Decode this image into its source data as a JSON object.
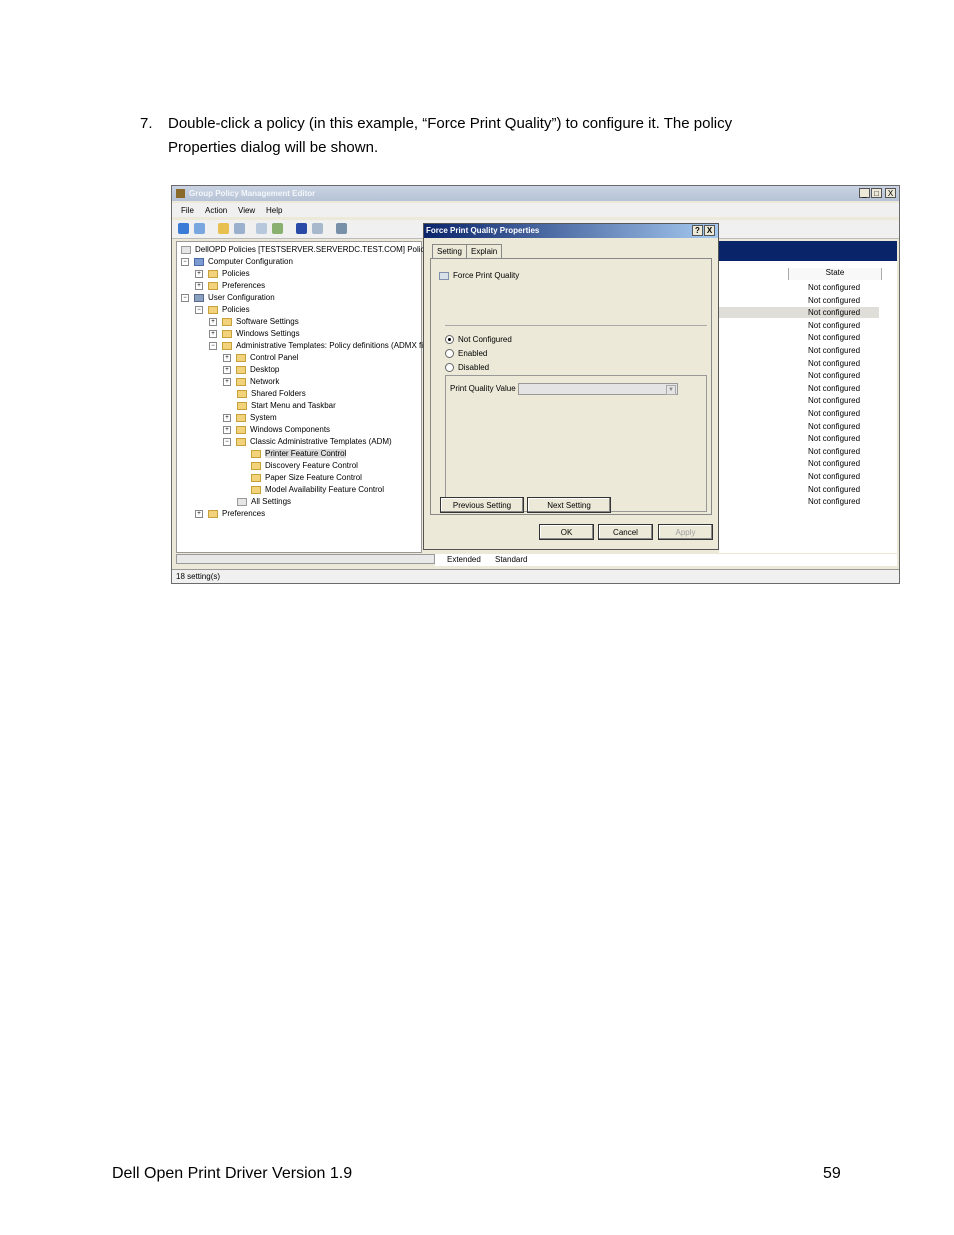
{
  "step": {
    "number": "7.",
    "line1": "Double-click a policy (in this example, “Force Print Quality”) to configure it.  The policy",
    "line2": "Properties dialog will be shown."
  },
  "window": {
    "title": "Group Policy Management Editor",
    "menu": [
      "File",
      "Action",
      "View",
      "Help"
    ],
    "min": "_",
    "max": "□",
    "close": "X"
  },
  "tree": [
    {
      "label": "DellOPD Policies [TESTSERVER.SERVERDC.TEST.COM] Policy"
    },
    {
      "label": "Computer Configuration"
    },
    {
      "label": "Policies"
    },
    {
      "label": "Preferences"
    },
    {
      "label": "User Configuration"
    },
    {
      "label": "Policies"
    },
    {
      "label": "Software Settings"
    },
    {
      "label": "Windows Settings"
    },
    {
      "label": "Administrative Templates: Policy definitions (ADMX fil"
    },
    {
      "label": "Control Panel"
    },
    {
      "label": "Desktop"
    },
    {
      "label": "Network"
    },
    {
      "label": "Shared Folders"
    },
    {
      "label": "Start Menu and Taskbar"
    },
    {
      "label": "System"
    },
    {
      "label": "Windows Components"
    },
    {
      "label": "Classic Administrative Templates (ADM)"
    },
    {
      "label": "Printer Feature Control"
    },
    {
      "label": "Discovery Feature Control"
    },
    {
      "label": "Paper Size Feature Control"
    },
    {
      "label": "Model Availability Feature Control"
    },
    {
      "label": "All Settings"
    },
    {
      "label": "Preferences"
    }
  ],
  "list": {
    "state_header": "State",
    "states": [
      "Not configured",
      "Not configured",
      "Not configured",
      "Not configured",
      "Not configured",
      "Not configured",
      "Not configured",
      "Not configured",
      "Not configured",
      "Not configured",
      "Not configured",
      "Not configured",
      "Not configured",
      "Not configured",
      "Not configured",
      "Not configured",
      "Not configured",
      "Not configured"
    ]
  },
  "bottom_tabs": [
    "Extended",
    "Standard"
  ],
  "status": "18 setting(s)",
  "dialog": {
    "title": "Force Print Quality Properties",
    "help": "?",
    "close": "X",
    "tabs": [
      "Setting",
      "Explain"
    ],
    "policy_name": "Force Print Quality",
    "options": [
      "Not Configured",
      "Enabled",
      "Disabled"
    ],
    "selected_option": "Not Configured",
    "value_label": "Print Quality Value",
    "prev_button": "Previous Setting",
    "next_button": "Next Setting",
    "ok_button": "OK",
    "cancel_button": "Cancel",
    "apply_button": "Apply"
  },
  "footer": {
    "title": "Dell Open Print Driver Version 1.9",
    "page": "59"
  }
}
